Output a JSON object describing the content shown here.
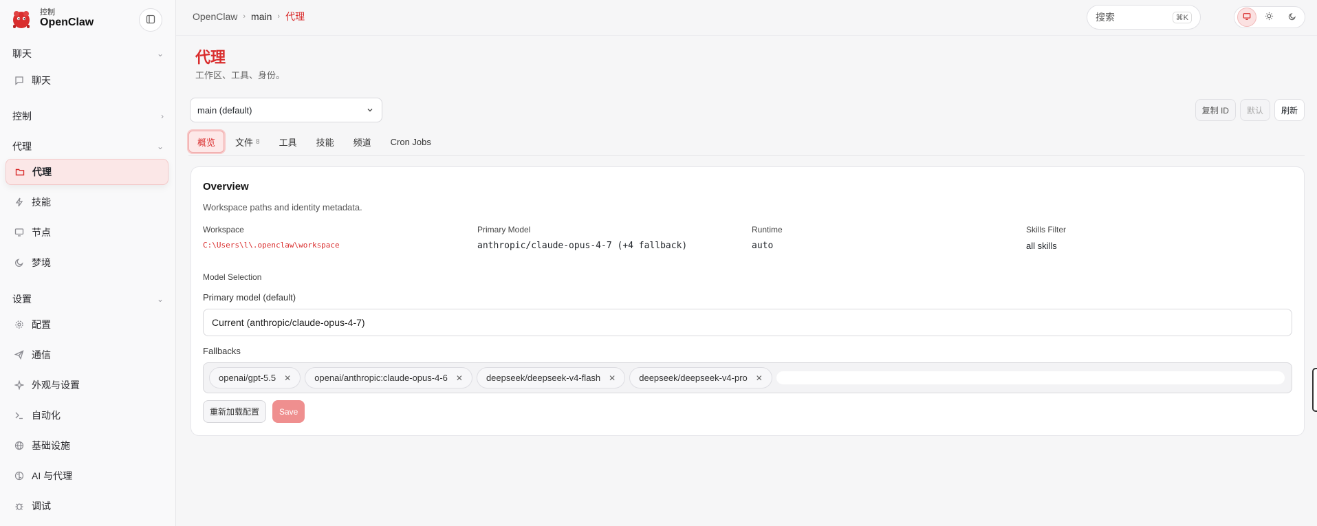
{
  "brand": {
    "subtitle": "控制",
    "name": "OpenClaw"
  },
  "sidebar": {
    "sections": [
      {
        "label": "聊天"
      },
      {
        "label": "控制"
      },
      {
        "label": "代理"
      },
      {
        "label": "设置"
      }
    ],
    "items": [
      {
        "label": "聊天",
        "icon": "message-icon"
      },
      {
        "label": "代理",
        "icon": "folder-icon",
        "active": true
      },
      {
        "label": "技能",
        "icon": "bolt-icon"
      },
      {
        "label": "节点",
        "icon": "monitor-icon"
      },
      {
        "label": "梦境",
        "icon": "moon-icon"
      },
      {
        "label": "配置",
        "icon": "gear-icon"
      },
      {
        "label": "通信",
        "icon": "send-icon"
      },
      {
        "label": "外观与设置",
        "icon": "sparkle-icon"
      },
      {
        "label": "自动化",
        "icon": "terminal-icon"
      },
      {
        "label": "基础设施",
        "icon": "globe-icon"
      },
      {
        "label": "AI 与代理",
        "icon": "brain-icon"
      },
      {
        "label": "调试",
        "icon": "bug-icon"
      }
    ]
  },
  "breadcrumb": {
    "items": [
      "OpenClaw",
      "main"
    ],
    "current": "代理"
  },
  "search": {
    "placeholder": "搜索",
    "shortcut": "⌘K"
  },
  "theme": {
    "options": [
      "monitor-icon",
      "sun-icon",
      "moon-icon"
    ],
    "active": "monitor-icon"
  },
  "page": {
    "title": "代理",
    "subtitle": "工作区、工具、身份。"
  },
  "agent_select": {
    "value": "main (default)"
  },
  "actions": {
    "copy_id": "复制 ID",
    "default": "默认",
    "refresh": "刷新"
  },
  "tabs": [
    {
      "label": "概览",
      "active": true
    },
    {
      "label": "文件",
      "count": "8"
    },
    {
      "label": "工具"
    },
    {
      "label": "技能"
    },
    {
      "label": "频道"
    },
    {
      "label": "Cron Jobs"
    }
  ],
  "overview": {
    "title": "Overview",
    "subtitle": "Workspace paths and identity metadata.",
    "workspace_label": "Workspace",
    "workspace_value": "C:\\Users\\l\\.openclaw\\workspace",
    "primary_model_label": "Primary Model",
    "primary_model_value": "anthropic/claude-opus-4-7 (+4 fallback)",
    "runtime_label": "Runtime",
    "runtime_value": "auto",
    "skills_filter_label": "Skills Filter",
    "skills_filter_value": "all skills",
    "model_selection_label": "Model Selection",
    "primary_default_label": "Primary model (default)",
    "primary_default_value": "Current (anthropic/claude-opus-4-7)",
    "fallbacks_label": "Fallbacks",
    "fallbacks": [
      "openai/gpt-5.5",
      "openai/anthropic:claude-opus-4-6",
      "deepseek/deepseek-v4-flash",
      "deepseek/deepseek-v4-pro"
    ],
    "reload_label": "重新加载配置",
    "save_label": "Save"
  },
  "colors": {
    "accent": "#d92d2d",
    "accent_soft": "#fde8e8",
    "save_disabled": "#ef8f8f"
  }
}
